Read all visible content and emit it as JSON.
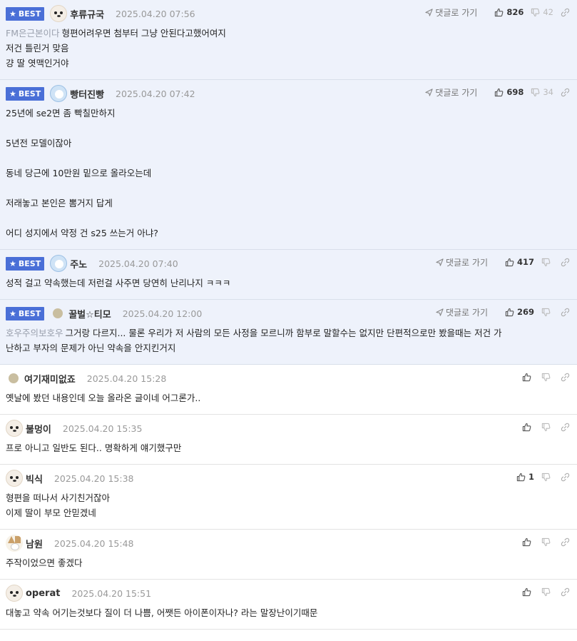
{
  "labels": {
    "best": "BEST",
    "reply_link": "댓글로 가기"
  },
  "comments": [
    {
      "best": true,
      "nick": "후류규국",
      "avatar": "puppy",
      "date": "2025.04.20 07:56",
      "likes": "826",
      "dislikes": "42",
      "quote": "FM은근본이다",
      "lines": [
        "형편어려우면 첨부터 그냥 안된다고했어여지",
        "저건 틀린거 맞음",
        "걍 딸 엿맥인거야"
      ]
    },
    {
      "best": true,
      "nick": "빵터진빵",
      "avatar": "blue",
      "date": "2025.04.20 07:42",
      "likes": "698",
      "dislikes": "34",
      "quote": "",
      "lines": [
        "25년에 se2면 좀 빡칠만하지",
        "",
        "5년전 모델이잖아",
        "",
        "동네 당근에 10만원 밑으로 올라오는데",
        "",
        "저래놓고 본인은 뽐거지 답게",
        "",
        "어디 성지에서 약정 건 s25 쓰는거 아냐?"
      ]
    },
    {
      "best": true,
      "nick": "주노",
      "avatar": "blue",
      "date": "2025.04.20 07:40",
      "likes": "417",
      "dislikes": "",
      "quote": "",
      "lines": [
        "성적 걸고 약속했는데 저런걸 사주면 당연히 난리나지 ㅋㅋㅋ"
      ]
    },
    {
      "best": true,
      "nick": "꿀벌☆티모",
      "avatar": "dot",
      "date": "2025.04.20 12:00",
      "likes": "269",
      "dislikes": "",
      "quote": "호우주의보호우",
      "lines": [
        "그거랑 다르지... 물론 우리가 저 사람의 모든 사정을 모르니까 함부로 말할수는 없지만 단편적으로만 봤을때는 저건 가",
        "난하고 부자의 문제가 아닌 약속을 안지킨거지"
      ]
    },
    {
      "best": false,
      "nick": "여기재미없죠",
      "avatar": "dot",
      "date": "2025.04.20 15:28",
      "likes": "",
      "dislikes": "",
      "quote": "",
      "lines": [
        "옛날에 봤던 내용인데 오늘 올라온 글이네 어그론가.."
      ]
    },
    {
      "best": false,
      "nick": "불멍이",
      "avatar": "puppy",
      "date": "2025.04.20 15:35",
      "likes": "",
      "dislikes": "",
      "quote": "",
      "lines": [
        "프로 아니고 일반도 된다.. 명확하게 얘기했구만"
      ]
    },
    {
      "best": false,
      "nick": "빅식",
      "avatar": "puppy",
      "date": "2025.04.20 15:38",
      "likes": "1",
      "dislikes": "",
      "quote": "",
      "lines": [
        "형편을 떠나서 사기친거잖아",
        "이제 딸이 부모 안믿겠네"
      ]
    },
    {
      "best": false,
      "nick": "남원",
      "avatar": "fox",
      "date": "2025.04.20 15:48",
      "likes": "",
      "dislikes": "",
      "quote": "",
      "lines": [
        "주작이었으면 좋겠다"
      ]
    },
    {
      "best": false,
      "nick": "operat",
      "avatar": "puppy",
      "date": "2025.04.20 15:51",
      "likes": "",
      "dislikes": "",
      "quote": "",
      "lines": [
        "대놓고 약속 어기는것보다 질이 더 나쁨, 어쨋든 아이폰이자나? 라는 말장난이기때문"
      ]
    }
  ]
}
